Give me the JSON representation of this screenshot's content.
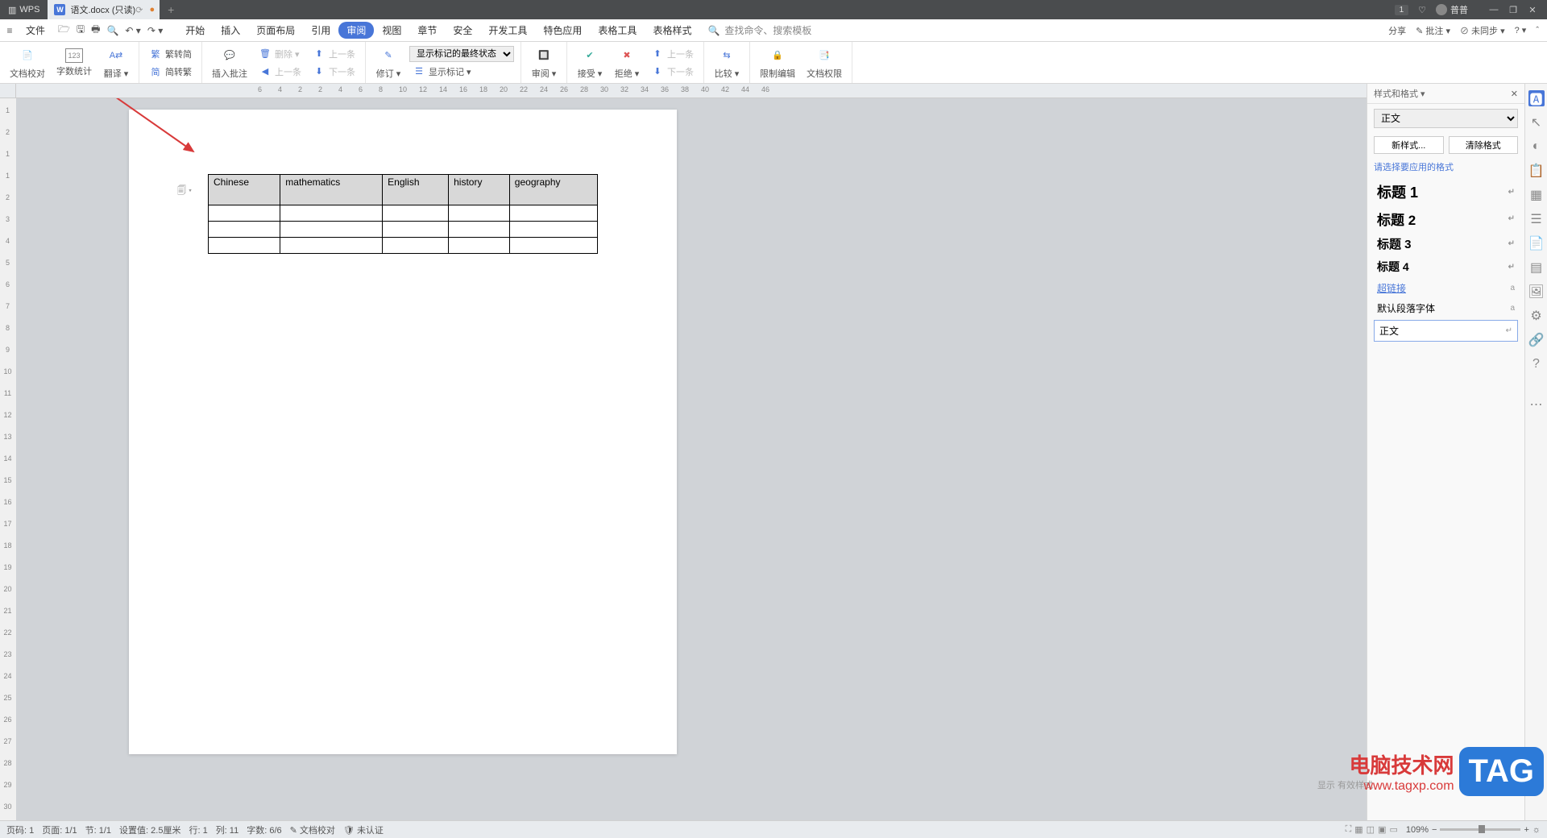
{
  "titlebar": {
    "logo": "WPS",
    "tab_name": "语文.docx (只读)",
    "badge": "1",
    "user": "普普"
  },
  "menubar": {
    "file": "文件",
    "tabs": [
      "开始",
      "插入",
      "页面布局",
      "引用",
      "审阅",
      "视图",
      "章节",
      "安全",
      "开发工具",
      "特色应用",
      "表格工具",
      "表格样式"
    ],
    "active_index": 4,
    "search_icon_label": "查找命令、搜索模板",
    "right": {
      "share": "分享",
      "note": "批注 ▾",
      "sync": "未同步 ▾"
    }
  },
  "ribbon": {
    "proof": "文档校对",
    "wordcount": "字数统计",
    "translate": "翻译 ▾",
    "trad_simp": "繁转简",
    "simp_trad": "简转繁",
    "insert_comment": "插入批注",
    "del_comment": "删除 ▾",
    "prev": "上一条",
    "next": "下一条",
    "prev2": "上一条",
    "next2": "下一条",
    "revise": "修订 ▾",
    "show_state": "显示标记的最终状态",
    "show_marks": "显示标记 ▾",
    "review": "审阅 ▾",
    "accept": "接受 ▾",
    "reject": "拒绝 ▾",
    "compare": "比较 ▾",
    "restrict": "限制编辑",
    "perm": "文档权限"
  },
  "table": {
    "headers": [
      "Chinese",
      "mathematics",
      "English",
      "history",
      "geography"
    ]
  },
  "styles_panel": {
    "title": "样式和格式 ▾",
    "current": "正文",
    "new_style": "新样式...",
    "clear": "清除格式",
    "hint": "请选择要应用的格式",
    "items": [
      {
        "label": "标题 1",
        "cls": "h1",
        "mark": "↵"
      },
      {
        "label": "标题 2",
        "cls": "h2",
        "mark": "↵"
      },
      {
        "label": "标题 3",
        "cls": "h3",
        "mark": "↵"
      },
      {
        "label": "标题 4",
        "cls": "h4",
        "mark": "↵"
      },
      {
        "label": "超链接",
        "cls": "link",
        "mark": "a"
      },
      {
        "label": "默认段落字体",
        "cls": "",
        "mark": "a"
      },
      {
        "label": "正文",
        "cls": "sel",
        "mark": "↵"
      }
    ],
    "display": "显示  有效样式"
  },
  "statusbar": {
    "page_no": "页码: 1",
    "page": "页面: 1/1",
    "section": "节: 1/1",
    "offset": "设置值: 2.5厘米",
    "row": "行: 1",
    "col": "列: 11",
    "words": "字数: 6/6",
    "proof": "文档校对",
    "verify": "未认证",
    "zoom": "109%"
  },
  "watermark": {
    "cn": "电脑技术网",
    "url": "www.tagxp.com",
    "tag": "TAG"
  },
  "hruler_ticks": [
    "6",
    "4",
    "2",
    "2",
    "4",
    "6",
    "8",
    "10",
    "12",
    "14",
    "16",
    "18",
    "20",
    "22",
    "24",
    "26",
    "28",
    "30",
    "32",
    "34",
    "36",
    "38",
    "40",
    "42",
    "44",
    "46"
  ],
  "vruler_ticks": [
    "1",
    "2",
    "1",
    "1",
    "2",
    "3",
    "4",
    "5",
    "6",
    "7",
    "8",
    "9",
    "10",
    "11",
    "12",
    "13",
    "14",
    "15",
    "16",
    "17",
    "18",
    "19",
    "20",
    "21",
    "22",
    "23",
    "24",
    "25",
    "26",
    "27",
    "28",
    "29",
    "30"
  ]
}
